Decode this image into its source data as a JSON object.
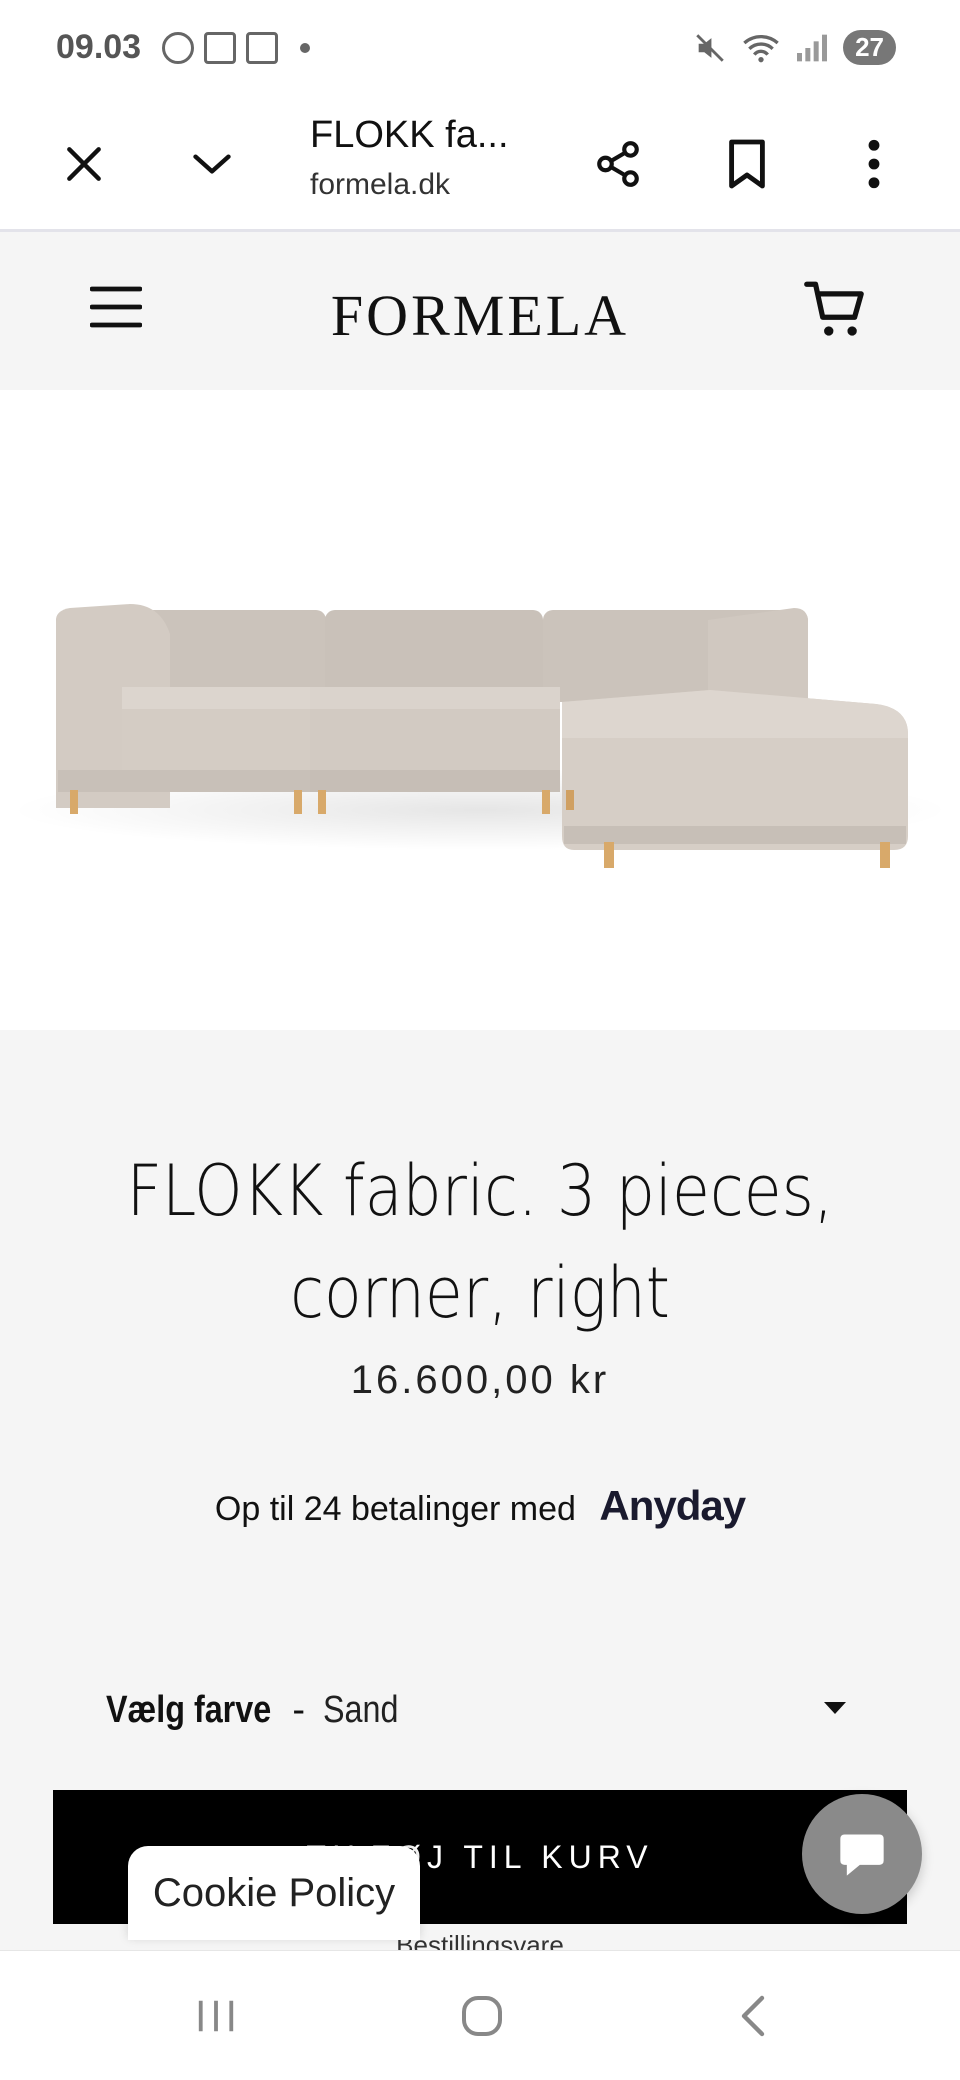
{
  "status_bar": {
    "time": "09.03",
    "battery": "27"
  },
  "browser": {
    "tab_title": "FLOKK fa...",
    "url": "formela.dk"
  },
  "site": {
    "logo": "FORMELA"
  },
  "product": {
    "title": "FLOKK fabric. 3 pieces, corner, right",
    "price": "16.600,00 kr",
    "installments_text": "Op til 24 betalinger med",
    "installments_brand": "Anyday",
    "variant_label": "Vælg farve",
    "variant_separator": "-",
    "variant_value": "Sand",
    "add_to_cart": "TILFØJ TIL KURV",
    "order_note": "Bestillingsvare"
  },
  "overlays": {
    "cookie_policy": "Cookie Policy"
  },
  "colors": {
    "sofa_fabric": "#cfc7bf",
    "sofa_legs": "#d8a96a",
    "header_bg": "#f5f5f5",
    "button_bg": "#000000",
    "chat_bubble": "#8a8a8a"
  }
}
